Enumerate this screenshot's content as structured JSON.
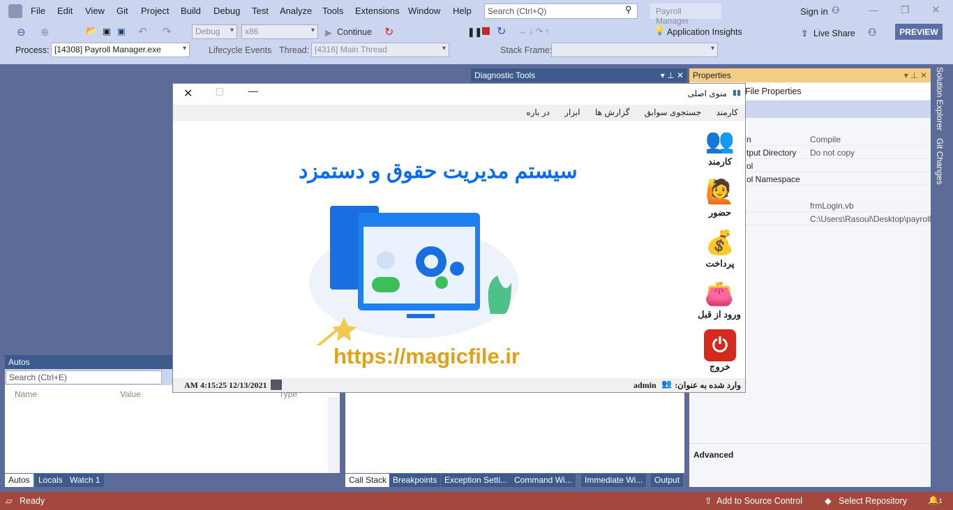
{
  "menu": [
    "File",
    "Edit",
    "View",
    "Git",
    "Project",
    "Build",
    "Debug",
    "Test",
    "Analyze",
    "Tools",
    "Extensions",
    "Window",
    "Help"
  ],
  "search": {
    "placeholder": "Search (Ctrl+Q)"
  },
  "solution_name": "Payroll Manager",
  "sign_in": "Sign in",
  "live_share": "Live Share",
  "preview": "PREVIEW",
  "toolbar": {
    "config": "Debug",
    "platform": "x86",
    "continue": "Continue",
    "app_insights": "Application Insights"
  },
  "debugbar": {
    "process_label": "Process:",
    "process": "[14308] Payroll Manager.exe",
    "lifecycle": "Lifecycle Events",
    "thread_label": "Thread:",
    "thread": "[4316] Main Thread",
    "stack_label": "Stack Frame:"
  },
  "diagnostic": {
    "title": "Diagnostic Tools"
  },
  "properties": {
    "title": "Properties",
    "object": "File Properties",
    "rows": [
      {
        "name": "n",
        "value": "Compile"
      },
      {
        "name": "tput Directory",
        "value": "Do not copy"
      },
      {
        "name": "ol",
        "value": ""
      },
      {
        "name": "ol Namespace",
        "value": ""
      },
      {
        "name": "",
        "value": "frmLogin.vb"
      },
      {
        "name": "",
        "value": "C:\\Users\\Rasoul\\Desktop\\payroll"
      }
    ],
    "advanced": "Advanced"
  },
  "side_tabs": [
    "Solution Explorer",
    "Git Changes"
  ],
  "autos": {
    "title": "Autos",
    "search_placeholder": "Search (Ctrl+E)",
    "columns": [
      "Name",
      "Value",
      "Type"
    ],
    "tabs": [
      "Autos",
      "Locals",
      "Watch 1"
    ]
  },
  "bottom_tabs": [
    "Call Stack",
    "Breakpoints",
    "Exception Setti...",
    "Command Wi...",
    "Immediate Wi...",
    "Output"
  ],
  "status": {
    "ready": "Ready",
    "add_source": "Add to Source Control",
    "select_repo": "Select Repository",
    "notifications": "1"
  },
  "app": {
    "title": "منوی اصلی",
    "menu": [
      "کارمند",
      "جستجوی سوابق",
      "گزارش ها",
      "ابزار",
      "در باره"
    ],
    "heading": "سیستم مدیریت حقوق و دستمزد",
    "url": "https://magicfile.ir",
    "side": [
      "کارمند",
      "حضور",
      "پرداخت",
      "ورود از قبل",
      "خروج"
    ],
    "datetime": "AM 4:15:25 12/13/2021",
    "logged_in_label": "وارد شده به عنوان:",
    "user": "admin"
  },
  "colors": {
    "accent": "#0a6cf0",
    "url": "#e0a21a",
    "status_bar": "#a4483e",
    "properties_header": "#f5cc84"
  }
}
